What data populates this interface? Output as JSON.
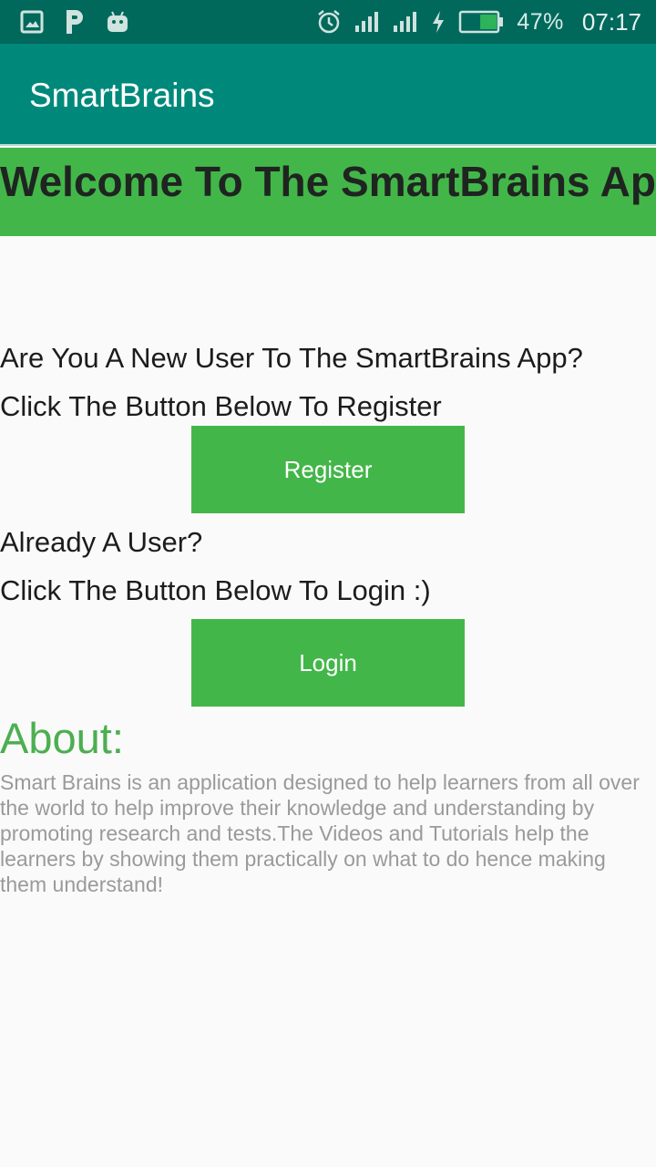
{
  "status_bar": {
    "left_icons": [
      "gallery-icon",
      "parking-icon",
      "android-icon"
    ],
    "right_icons": [
      "alarm-icon",
      "signal-icon",
      "signal-icon",
      "charging-icon",
      "battery-icon"
    ],
    "battery_level": 0.47,
    "battery_text": "47%",
    "time": "07:17"
  },
  "app_bar": {
    "title": "SmartBrains"
  },
  "welcome": {
    "text": "Welcome To The SmartBrains App"
  },
  "register_section": {
    "question": "Are You A New User To The SmartBrains App?",
    "instruction": "Click The Button Below To Register",
    "button_label": "Register"
  },
  "login_section": {
    "question": "Already A User?",
    "instruction": "Click The Button Below To Login :)",
    "button_label": "Login"
  },
  "about": {
    "heading": "About:",
    "body": "Smart Brains is an application designed to help learners from all over the world to help improve their knowledge and understanding by promoting research and tests.The Videos and Tutorials help the learners by showing them practically on what to do hence making them understand!"
  },
  "colors": {
    "status_bar": "#00695c",
    "app_bar": "#00897b",
    "accent_green": "#43b649",
    "about_heading": "#4caf50",
    "about_text": "#9a9a9a"
  }
}
